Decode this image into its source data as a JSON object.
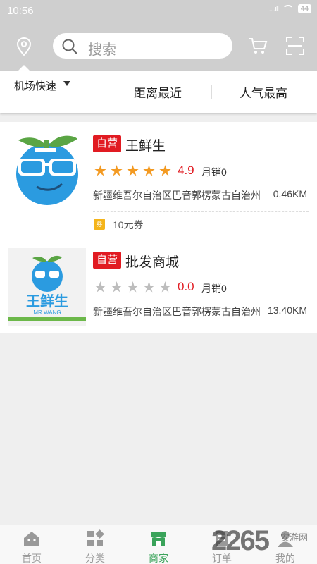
{
  "status_bar": {
    "time": "10:56",
    "signal": "....ıll",
    "battery": "44"
  },
  "header": {
    "search_placeholder": "搜索"
  },
  "filters": [
    {
      "label": "机场快速"
    },
    {
      "label": "距离最近"
    },
    {
      "label": "人气最高"
    }
  ],
  "stores": [
    {
      "badge": "自营",
      "name": "王鲜生",
      "rating": "4.9",
      "rating_value": 4.9,
      "stars_filled": 5,
      "sales": "月销0",
      "address": "新疆维吾尔自治区巴音郭楞蒙古自治州",
      "distance": "0.46KM",
      "coupon_icon": "券",
      "coupon": "10元券"
    },
    {
      "badge": "自营",
      "name": "批发商城",
      "rating": "0.0",
      "rating_value": 0.0,
      "stars_filled": 0,
      "sales": "月销0",
      "address": "新疆维吾尔自治区巴音郭楞蒙古自治州",
      "distance": "13.40KM",
      "logo_text": "王鲜生",
      "logo_subtext": "MR WANG"
    }
  ],
  "bottom_nav": [
    {
      "label": "首页",
      "icon": "home-icon"
    },
    {
      "label": "分类",
      "icon": "category-icon"
    },
    {
      "label": "商家",
      "icon": "store-icon",
      "active": true
    },
    {
      "label": "订单",
      "icon": "order-icon"
    },
    {
      "label": "我的",
      "icon": "profile-icon"
    }
  ],
  "watermark": {
    "text": "2265",
    "subtext": "安游网"
  },
  "colors": {
    "accent": "#3aa35a",
    "badge": "#e11b22",
    "star": "#f39a22",
    "header_bg": "#cfcfcf"
  }
}
